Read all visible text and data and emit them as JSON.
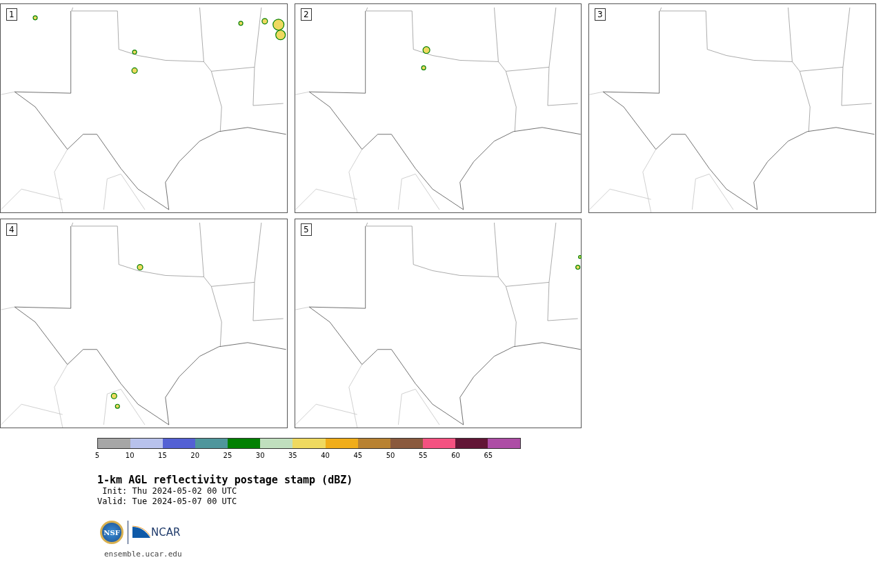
{
  "panels": [
    {
      "label": "1"
    },
    {
      "label": "2"
    },
    {
      "label": "3"
    },
    {
      "label": "4"
    },
    {
      "label": "5"
    }
  ],
  "colorbar": {
    "bins": [
      {
        "color": "#a6a6a6"
      },
      {
        "color": "#b8c2ec"
      },
      {
        "color": "#5461d4"
      },
      {
        "color": "#50969c"
      },
      {
        "color": "#028002"
      },
      {
        "color": "#c0dfbe"
      },
      {
        "color": "#efd960"
      },
      {
        "color": "#f0ad19"
      },
      {
        "color": "#b88232"
      },
      {
        "color": "#8a5a3e"
      },
      {
        "color": "#f45281"
      },
      {
        "color": "#621636"
      },
      {
        "color": "#ad4da5"
      }
    ],
    "ticks": [
      "5",
      "10",
      "15",
      "20",
      "25",
      "30",
      "35",
      "40",
      "45",
      "50",
      "55",
      "60",
      "65"
    ]
  },
  "title": "1-km AGL reflectivity postage stamp (dBZ)",
  "init": " Init: Thu 2024-05-02 00 UTC",
  "valid": "Valid: Tue 2024-05-07 00 UTC",
  "logo": {
    "nsf": "NSF",
    "ncar": "NCAR"
  },
  "site": "ensemble.ucar.edu"
}
